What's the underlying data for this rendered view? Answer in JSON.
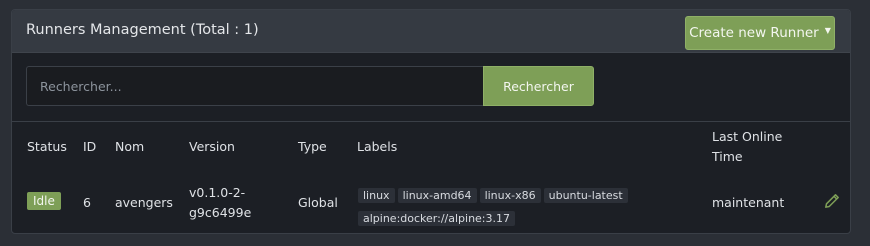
{
  "header": {
    "title": "Runners Management (Total : 1)",
    "create_button": "Create new Runner"
  },
  "search": {
    "placeholder": "Rechercher...",
    "value": "",
    "button": "Rechercher"
  },
  "table": {
    "columns": {
      "status": "Status",
      "id": "ID",
      "name": "Nom",
      "version": "Version",
      "type": "Type",
      "labels": "Labels",
      "last_online_line1": "Last Online",
      "last_online_line2": "Time"
    },
    "rows": [
      {
        "status": "Idle",
        "id": "6",
        "name": "avengers",
        "version_line1": "v0.1.0-2-",
        "version_line2": "g9c6499e",
        "type": "Global",
        "labels": [
          "linux",
          "linux-amd64",
          "linux-x86",
          "ubuntu-latest",
          "alpine:docker://alpine:3.17"
        ],
        "last_online": "maintenant"
      }
    ]
  },
  "icons": {
    "edit": "pencil-icon"
  },
  "colors": {
    "accent": "#7e9f57",
    "panel_bg": "#1c1f25",
    "header_bg": "#353a42"
  }
}
